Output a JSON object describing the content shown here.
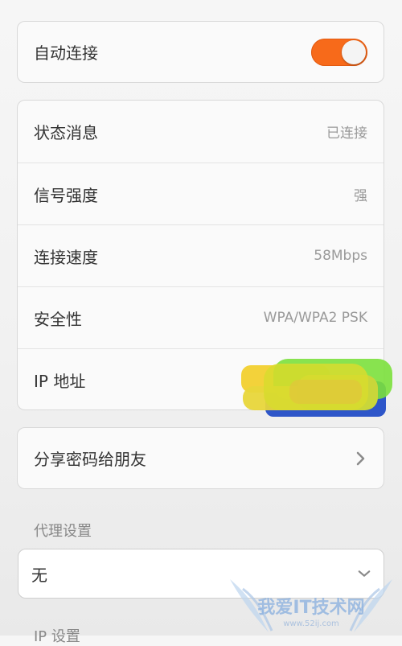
{
  "auto_connect": {
    "label": "自动连接",
    "enabled": true,
    "accent": "#f76a1a"
  },
  "info_rows": [
    {
      "label": "状态消息",
      "value": "已连接"
    },
    {
      "label": "信号强度",
      "value": "强"
    },
    {
      "label": "连接速度",
      "value": "58Mbps"
    },
    {
      "label": "安全性",
      "value": "WPA/WPA2 PSK"
    },
    {
      "label": "IP 地址",
      "value": ""
    }
  ],
  "share": {
    "label": "分享密码给朋友",
    "icon": "chevron-right-icon"
  },
  "proxy": {
    "section_title": "代理设置",
    "selected": "无",
    "icon": "chevron-down-icon"
  },
  "ip_settings": {
    "section_title": "IP 设置"
  },
  "watermark": {
    "text": "我爱IT技术网",
    "url": "www.52ij.com"
  }
}
